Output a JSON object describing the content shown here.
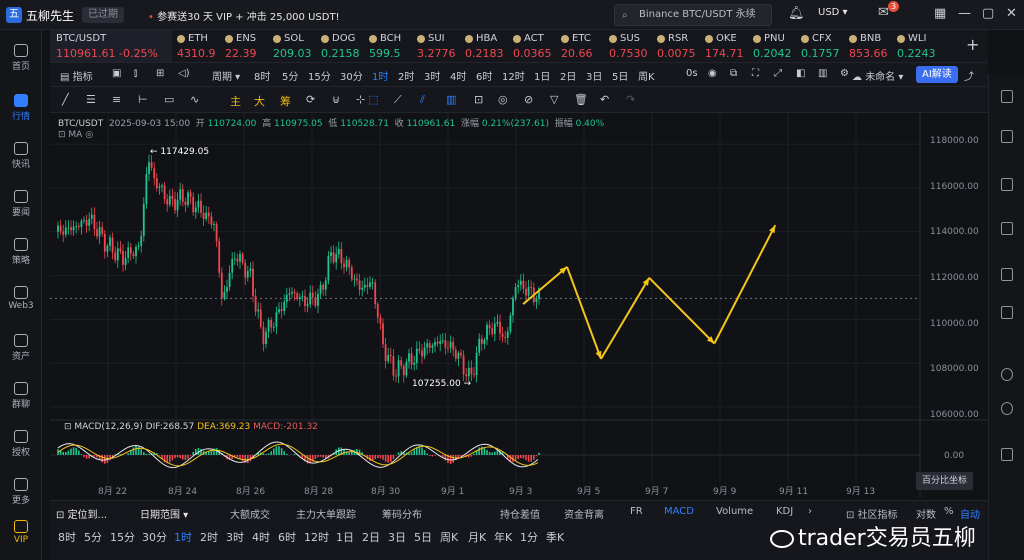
{
  "header": {
    "logo_text": "五",
    "brand": "五柳先生",
    "tag": "已过期",
    "promo_prefix": "•",
    "promo": "参赛送30 天 VIP + 冲击 25,000 USDT!",
    "search_placeholder": "Binance BTC/USDT 永续",
    "currency": "USD",
    "notifications": "3"
  },
  "sidebar": {
    "items": [
      {
        "label": "首页",
        "icon": "home-icon"
      },
      {
        "label": "行情",
        "icon": "chart-bars-icon",
        "active": true
      },
      {
        "label": "快讯",
        "icon": "news-icon"
      },
      {
        "label": "要闻",
        "icon": "headline-icon"
      },
      {
        "label": "策略",
        "icon": "robot-icon"
      },
      {
        "label": "Web3",
        "icon": "web3-icon"
      },
      {
        "label": "资产",
        "icon": "wallet-icon"
      },
      {
        "label": "群聊",
        "icon": "chat-icon"
      },
      {
        "label": "授权",
        "icon": "key-icon"
      },
      {
        "label": "更多",
        "icon": "more-icon"
      },
      {
        "label": "VIP",
        "icon": "vip-icon"
      }
    ]
  },
  "ticker": [
    {
      "symbol": "BTC/USDT",
      "value": "110961.61  -0.25%",
      "dir": "dn"
    },
    {
      "symbol": "ETH",
      "value": "4310.9",
      "dir": "dn"
    },
    {
      "symbol": "ENS",
      "value": "22.39",
      "dir": "dn"
    },
    {
      "symbol": "SOL",
      "value": "209.03",
      "dir": "up"
    },
    {
      "symbol": "DOG",
      "value": "0.2158",
      "dir": "up"
    },
    {
      "symbol": "BCH",
      "value": "599.5",
      "dir": "up"
    },
    {
      "symbol": "SUI",
      "value": "3.2776",
      "dir": "dn"
    },
    {
      "symbol": "HBA",
      "value": "0.2183",
      "dir": "dn"
    },
    {
      "symbol": "ACT",
      "value": "0.0365",
      "dir": "dn"
    },
    {
      "symbol": "ETC",
      "value": "20.66",
      "dir": "dn"
    },
    {
      "symbol": "SUS",
      "value": "0.7530",
      "dir": "dn"
    },
    {
      "symbol": "RSR",
      "value": "0.0075",
      "dir": "dn"
    },
    {
      "symbol": "OKE",
      "value": "174.71",
      "dir": "dn"
    },
    {
      "symbol": "PNU",
      "value": "0.2042",
      "dir": "up"
    },
    {
      "symbol": "CFX",
      "value": "0.1757",
      "dir": "up"
    },
    {
      "symbol": "BNB",
      "value": "853.66",
      "dir": "dn"
    },
    {
      "symbol": "WLI",
      "value": "0.2243",
      "dir": "up"
    }
  ],
  "toolbar": {
    "indicator": "指标",
    "period": "周期",
    "intervals": [
      "8时",
      "5分",
      "15分",
      "30分",
      "1时",
      "2时",
      "3时",
      "4时",
      "6时",
      "12时",
      "1日",
      "2日",
      "3日",
      "5日",
      "周K"
    ],
    "active_interval": "1时",
    "replay": "0s",
    "layout_name": "未命名",
    "ai": "AI解读"
  },
  "drawbar": {
    "labels": [
      "主",
      "大",
      "筹"
    ]
  },
  "chart": {
    "symbol": "BTC/USDT",
    "date": "2025-09-03 15:00",
    "open_label": "开",
    "open": "110724.00",
    "high_label": "高",
    "high": "110975.05",
    "low_label": "低",
    "low": "110528.71",
    "close_label": "收",
    "close": "110961.61",
    "change_label": "涨幅",
    "change": "0.21%(237.61)",
    "amp_label": "振幅",
    "amp": "0.40%",
    "ma_label": "MA",
    "high_marker": "117429.05",
    "low_marker": "107255.00",
    "y_labels": [
      "118000.00",
      "116000.00",
      "114000.00",
      "112000.00",
      "110000.00",
      "108000.00",
      "106000.00"
    ],
    "macd_label": "MACD(12,26,9)",
    "dif": "DIF:268.57",
    "dea": "DEA:369.23",
    "macd": "MACD:-201.32",
    "macd_zero": "0.00",
    "x_labels": [
      "8月 22",
      "8月 24",
      "8月 26",
      "8月 28",
      "8月 30",
      "9月 1",
      "9月 3",
      "9月 5",
      "9月 7",
      "9月 9",
      "9月 11",
      "9月 13"
    ],
    "pct_tip": "百分比坐标"
  },
  "chart_data": {
    "type": "line",
    "title": "BTC/USDT",
    "xlabel": "",
    "ylabel": "",
    "ylim": [
      105500,
      118600
    ],
    "series": [
      {
        "x": [
          "2025-09-03 05:00",
          "2025-09-04 12:00",
          "2025-09-05 12:00",
          "2025-09-06 22:00",
          "2025-09-08 20:00",
          "2025-09-10 15:00"
        ],
        "values": [
          110700,
          112400,
          108200,
          111900,
          108900,
          114300
        ]
      }
    ],
    "candles_summary": {
      "high": 117429.05,
      "low": 107255.0,
      "last": 110961.61
    },
    "grid": true,
    "colors": {
      "up": "#1fc58e",
      "down": "#f0474f",
      "projection": "#f5c518",
      "dif": "#e8e8e8",
      "dea": "#f0c419"
    }
  },
  "bottom": {
    "tabs": [
      "定位到...",
      "日期范围",
      "大额成交",
      "主力大单跟踪",
      "筹码分布",
      "持仓差值",
      "资金背离",
      "FR",
      "MACD",
      "Volume",
      "KDJ",
      "社区指标",
      "对数",
      "%",
      "自动"
    ],
    "active": "MACD",
    "intervals": [
      "8时",
      "5分",
      "15分",
      "30分",
      "1时",
      "2时",
      "3时",
      "4时",
      "6时",
      "12时",
      "1日",
      "2日",
      "3日",
      "5日",
      "周K",
      "月K",
      "年K",
      "1分",
      "季K"
    ],
    "active_interval": "1时"
  },
  "watermark": "trader交易员五柳"
}
